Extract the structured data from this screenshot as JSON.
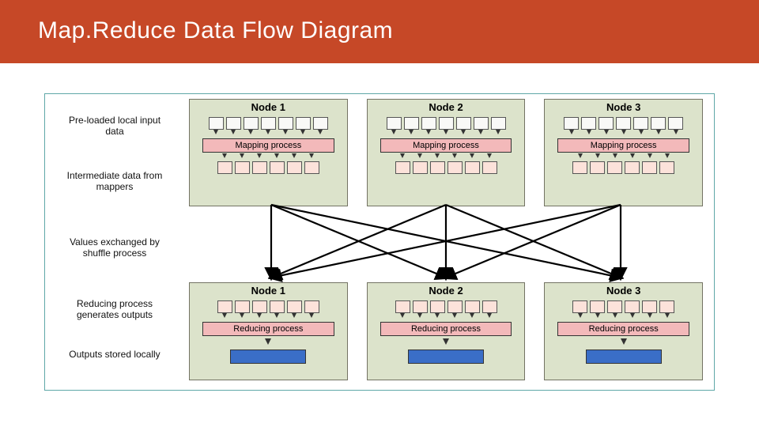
{
  "header": {
    "title": "Map.Reduce Data Flow Diagram"
  },
  "labels": {
    "input": "Pre-loaded local input data",
    "intermediate": "Intermediate data from mappers",
    "shuffle": "Values exchanged by shuffle process",
    "reduce": "Reducing process generates outputs",
    "output": "Outputs stored locally"
  },
  "nodes": {
    "map": [
      "Node 1",
      "Node 2",
      "Node 3"
    ],
    "reduce": [
      "Node 1",
      "Node 2",
      "Node 3"
    ],
    "mapping_label": "Mapping process",
    "reducing_label": "Reducing process"
  },
  "counts": {
    "input_cells": 7,
    "intermediate_cells": 6,
    "reduce_input_cells": 6
  }
}
